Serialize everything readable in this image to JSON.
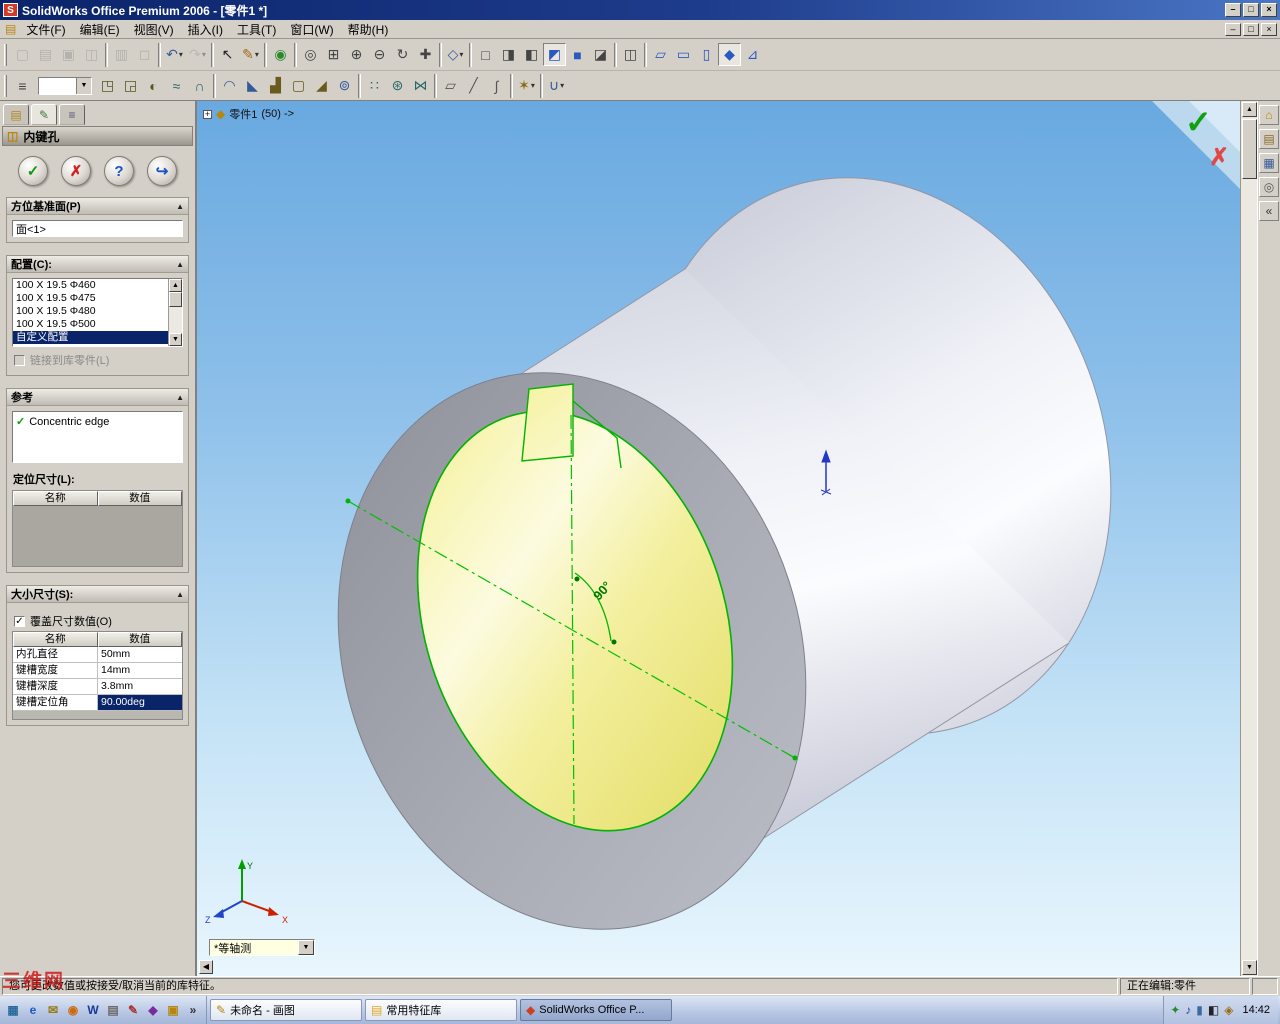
{
  "window_controls": {
    "minimize": "–",
    "maximize": "□",
    "close": "×"
  },
  "titlebar": {
    "title": "SolidWorks Office Premium 2006 - [零件1 *]"
  },
  "menubar": {
    "items": [
      {
        "label": "文件(F)"
      },
      {
        "label": "编辑(E)"
      },
      {
        "label": "视图(V)"
      },
      {
        "label": "插入(I)"
      },
      {
        "label": "工具(T)"
      },
      {
        "label": "窗口(W)"
      },
      {
        "label": "帮助(H)"
      }
    ]
  },
  "toolbar1": {
    "icons": [
      {
        "name": "new-icon",
        "glyph": "▢",
        "color": "#8a8a8a",
        "disabled": true
      },
      {
        "name": "open-icon",
        "glyph": "▤",
        "color": "#8a8a8a",
        "disabled": true
      },
      {
        "name": "save-icon",
        "glyph": "▣",
        "color": "#8a8a8a",
        "disabled": true
      },
      {
        "name": "make-drawing-icon",
        "glyph": "◫",
        "color": "#8a8a8a",
        "disabled": true
      },
      {
        "sep": true
      },
      {
        "name": "print-icon",
        "glyph": "▥",
        "color": "#8a8a8a",
        "disabled": true
      },
      {
        "name": "print-preview-icon",
        "glyph": "◻",
        "color": "#8a8a8a",
        "disabled": true
      },
      {
        "sep": true
      },
      {
        "name": "undo-icon",
        "glyph": "↶",
        "color": "#3a5a9a",
        "dropdown": true
      },
      {
        "name": "redo-icon",
        "glyph": "↷",
        "color": "#9a9a9a",
        "dropdown": true,
        "disabled": true
      },
      {
        "sep": true
      },
      {
        "name": "select-icon",
        "glyph": "↖",
        "color": "#222222"
      },
      {
        "name": "sketch-icon",
        "glyph": "✎",
        "color": "#a06a1a",
        "dropdown": true
      },
      {
        "sep": true
      },
      {
        "name": "rebuild-icon",
        "glyph": "◉",
        "color": "#2a8a2a"
      },
      {
        "sep": true
      },
      {
        "name": "zoom-fit-icon",
        "glyph": "◎",
        "color": "#444444"
      },
      {
        "name": "zoom-area-icon",
        "glyph": "⊞",
        "color": "#444444"
      },
      {
        "name": "zoom-in-out-icon",
        "glyph": "⊕",
        "color": "#444444"
      },
      {
        "name": "zoom-selection-icon",
        "glyph": "⊖",
        "color": "#444444"
      },
      {
        "name": "rotate-view-icon",
        "glyph": "↻",
        "color": "#444444"
      },
      {
        "name": "pan-icon",
        "glyph": "✚",
        "color": "#444444"
      },
      {
        "sep": true
      },
      {
        "name": "standard-views-icon",
        "glyph": "◇",
        "color": "#3a5a9a",
        "dropdown": true
      },
      {
        "sep": true
      },
      {
        "name": "wireframe-icon",
        "glyph": "□",
        "color": "#444444"
      },
      {
        "name": "hidden-lines-visible-icon",
        "glyph": "◨",
        "color": "#444444"
      },
      {
        "name": "hidden-lines-removed-icon",
        "glyph": "◧",
        "color": "#444444"
      },
      {
        "name": "shaded-with-edges-icon",
        "glyph": "◩",
        "color": "#2a5ac0",
        "pressed": true
      },
      {
        "name": "shaded-icon",
        "glyph": "■",
        "color": "#2a5ac0"
      },
      {
        "name": "shadows-icon",
        "glyph": "◪",
        "color": "#444444"
      },
      {
        "sep": true
      },
      {
        "name": "section-view-icon",
        "glyph": "◫",
        "color": "#444444"
      },
      {
        "sep": true
      },
      {
        "name": "front-view-icon",
        "glyph": "▱",
        "color": "#2a5ac0"
      },
      {
        "name": "top-view-icon",
        "glyph": "▭",
        "color": "#2a5ac0"
      },
      {
        "name": "left-view-icon",
        "glyph": "▯",
        "color": "#2a5ac0"
      },
      {
        "name": "isometric-view-icon",
        "glyph": "◆",
        "color": "#2a5ac0",
        "pressed": true
      },
      {
        "name": "normal-to-icon",
        "glyph": "⊿",
        "color": "#2a5ac0"
      }
    ]
  },
  "toolbar2": {
    "lead_glyph": "≡",
    "combo_value": "",
    "icons": [
      {
        "name": "extruded-boss-icon",
        "glyph": "◳",
        "color": "#56561e"
      },
      {
        "name": "extruded-cut-icon",
        "glyph": "◲",
        "color": "#56561e"
      },
      {
        "name": "revolved-boss-icon",
        "glyph": "◐",
        "color": "#56561e"
      },
      {
        "name": "swept-boss-icon",
        "glyph": "≈",
        "color": "#2a6a6a"
      },
      {
        "name": "lofted-boss-icon",
        "glyph": "∩",
        "color": "#2a6a6a"
      },
      {
        "sep": true
      },
      {
        "name": "fillet-icon",
        "glyph": "◠",
        "color": "#34589a"
      },
      {
        "name": "chamfer-icon",
        "glyph": "◣",
        "color": "#34589a"
      },
      {
        "name": "rib-icon",
        "glyph": "▟",
        "color": "#6a5a1e"
      },
      {
        "name": "shell-icon",
        "glyph": "▢",
        "color": "#6a5a1e"
      },
      {
        "name": "draft-icon",
        "glyph": "◢",
        "color": "#6a5a1e"
      },
      {
        "name": "hole-wizard-icon",
        "glyph": "⊚",
        "color": "#34589a"
      },
      {
        "sep": true
      },
      {
        "name": "linear-pattern-icon",
        "glyph": "∷",
        "color": "#2a6a6a"
      },
      {
        "name": "circular-pattern-icon",
        "glyph": "⊛",
        "color": "#2a6a6a"
      },
      {
        "name": "mirror-icon",
        "glyph": "⋈",
        "color": "#2a6a6a"
      },
      {
        "sep": true
      },
      {
        "name": "reference-plane-icon",
        "glyph": "▱",
        "color": "#565656"
      },
      {
        "name": "reference-axis-icon",
        "glyph": "╱",
        "color": "#565656"
      },
      {
        "name": "curve-icon",
        "glyph": "∫",
        "color": "#565656"
      },
      {
        "sep": true
      },
      {
        "name": "library-feature-dropdown-icon",
        "glyph": "✶",
        "color": "#8a6a10",
        "dropdown": true
      },
      {
        "sep": true
      },
      {
        "name": "block-dropdown-icon",
        "glyph": "∪",
        "color": "#34589a",
        "dropdown": true
      }
    ]
  },
  "pm": {
    "tabs": [
      {
        "name": "feature-manager-tab",
        "glyph": "▤",
        "color": "#b08820"
      },
      {
        "name": "property-manager-tab",
        "glyph": "✎",
        "color": "#3a7a3a",
        "active": true
      },
      {
        "name": "configuration-manager-tab",
        "glyph": "≡",
        "color": "#555577"
      }
    ],
    "title": "内键孔",
    "header_icon": "◫",
    "buttons": {
      "ok": "✓",
      "cancel": "✗",
      "help": "?",
      "preview": "↪"
    },
    "orientation": {
      "label": "方位基准面(P)",
      "value": "面<1>"
    },
    "config": {
      "label": "配置(C):",
      "items": [
        {
          "label": "100 X 19.5 Φ460"
        },
        {
          "label": "100 X 19.5 Φ475"
        },
        {
          "label": "100 X 19.5 Φ480"
        },
        {
          "label": "100 X 19.5 Φ500"
        },
        {
          "label": "自定义配置",
          "selected": true
        }
      ],
      "link_label": "链接到库零件(L)"
    },
    "reference": {
      "label": "参考",
      "value": "Concentric edge",
      "locating_label": "定位尺寸(L):",
      "headers": {
        "name": "名称",
        "value": "数值"
      }
    },
    "size": {
      "label": "大小尺寸(S):",
      "override_label": "覆盖尺寸数值(O)",
      "headers": {
        "name": "名称",
        "value": "数值"
      },
      "rows": [
        {
          "name": "内孔直径",
          "value": "50mm"
        },
        {
          "name": "键槽宽度",
          "value": "14mm"
        },
        {
          "name": "键槽深度",
          "value": "3.8mm"
        },
        {
          "name": "键槽定位角",
          "value": "90.00deg",
          "selected": true
        }
      ]
    }
  },
  "viewport": {
    "breadcrumb": {
      "part": "零件1",
      "suffix": "(50) ->"
    },
    "angle_label": "90°",
    "view_selector": "*等轴测",
    "triad": {
      "x": "X",
      "y": "Y",
      "z": "Z"
    }
  },
  "scrollbar": {
    "up": "▲",
    "down": "▼",
    "left": "◀"
  },
  "right_panel": {
    "icons": [
      {
        "name": "solidworks-resources-icon",
        "glyph": "⌂",
        "color": "#b8860b"
      },
      {
        "name": "design-library-icon",
        "glyph": "▤",
        "color": "#8a6a2a"
      },
      {
        "name": "file-explorer-icon",
        "glyph": "▦",
        "color": "#34589a"
      },
      {
        "name": "search-icon",
        "glyph": "◎",
        "color": "#555555"
      },
      {
        "name": "collapse-panel-icon",
        "glyph": "«",
        "color": "#333333"
      }
    ]
  },
  "statusbar": {
    "message": "您可更改数值或按接受/取消当前的库特征。",
    "editing": "正在编辑:零件"
  },
  "taskbar": {
    "quick_launch": [
      {
        "name": "show-desktop-icon",
        "glyph": "▦",
        "color": "#2a6a9a"
      },
      {
        "name": "ie-icon",
        "glyph": "e",
        "color": "#1a5ac8"
      },
      {
        "name": "outlook-icon",
        "glyph": "✉",
        "color": "#9a7a10"
      },
      {
        "name": "media-player-icon",
        "glyph": "◉",
        "color": "#cc6a10"
      },
      {
        "name": "word-icon",
        "glyph": "W",
        "color": "#1a3a9a"
      },
      {
        "name": "notepad-icon",
        "glyph": "▤",
        "color": "#6a6a6a"
      },
      {
        "name": "paint-icon",
        "glyph": "✎",
        "color": "#aa3333"
      },
      {
        "name": "messenger-icon",
        "glyph": "◆",
        "color": "#7a2a9a"
      },
      {
        "name": "folder-icon",
        "glyph": "▣",
        "color": "#b8860b"
      },
      {
        "name": "overflow-chevron-icon",
        "glyph": "»",
        "color": "#333333"
      }
    ],
    "buttons": [
      {
        "name": "taskbar-button-paint",
        "glyph": "✎",
        "color": "#b8860b",
        "label": "未命名 - 画图"
      },
      {
        "name": "taskbar-button-library",
        "glyph": "▤",
        "color": "#e0a820",
        "label": "常用特征库"
      },
      {
        "name": "taskbar-button-solidworks",
        "glyph": "◆",
        "color": "#d04020",
        "label": "SolidWorks Office P...",
        "active": true
      }
    ],
    "tray_icons": [
      {
        "name": "antivirus-tray-icon",
        "glyph": "✦",
        "color": "#2a8a2a"
      },
      {
        "name": "volume-tray-icon",
        "glyph": "♪",
        "color": "#2a4a9a"
      },
      {
        "name": "network-tray-icon",
        "glyph": "▮",
        "color": "#3a6aa0"
      },
      {
        "name": "ime-tray-icon",
        "glyph": "◧",
        "color": "#222222"
      },
      {
        "name": "update-tray-icon",
        "glyph": "◈",
        "color": "#a06a10"
      }
    ],
    "time": "14:42"
  },
  "watermark": {
    "text": "三维网"
  }
}
